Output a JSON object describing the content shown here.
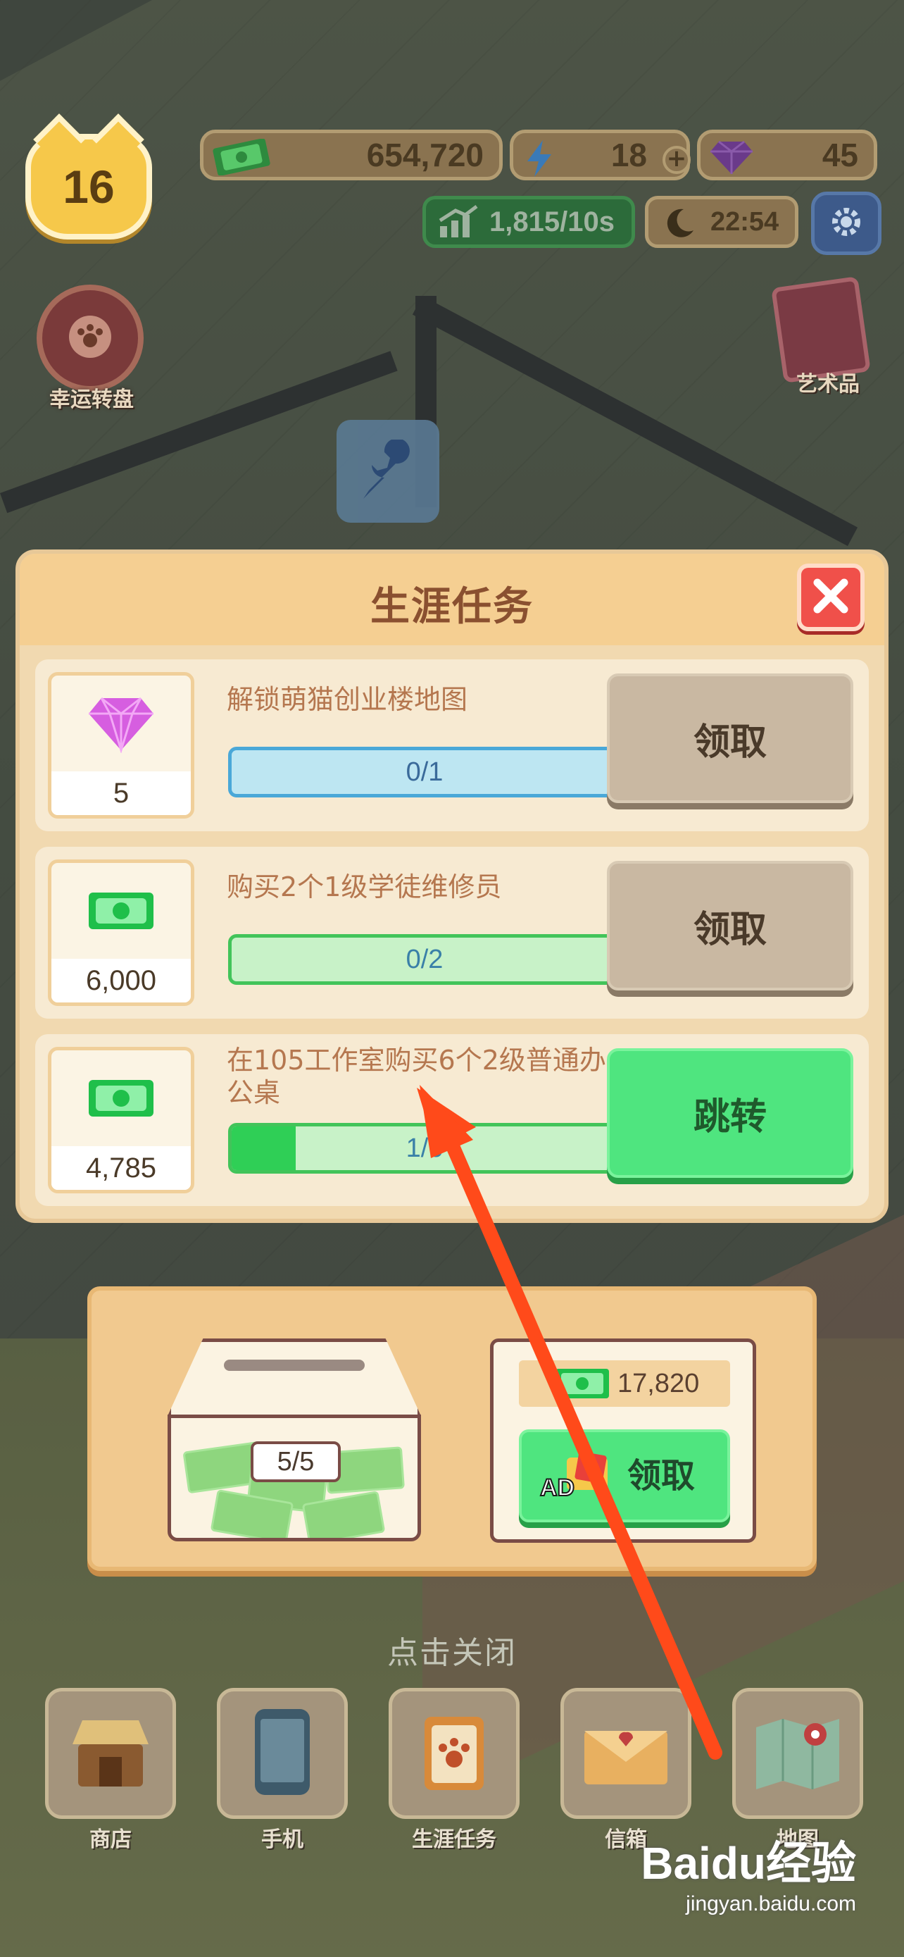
{
  "hud": {
    "level": "16",
    "cash": "654,720",
    "energy": "18",
    "gems": "45",
    "income_rate": "1,815/10s",
    "game_time": "22:54",
    "lucky_wheel_label": "幸运转盘",
    "art_label": "艺术品"
  },
  "modal": {
    "title": "生涯任务",
    "tasks": [
      {
        "reward_icon": "gem-icon",
        "reward_amount": "5",
        "description": "解锁萌猫创业楼地图",
        "progress_text": "0/1",
        "progress": 0.0,
        "button_label": "领取",
        "button_state": "disabled"
      },
      {
        "reward_icon": "cash-icon",
        "reward_amount": "6,000",
        "description": "购买2个1级学徒维修员",
        "progress_text": "0/2",
        "progress": 0.0,
        "button_label": "领取",
        "button_state": "disabled"
      },
      {
        "reward_icon": "cash-icon",
        "reward_amount": "4,785",
        "description": "在105工作室购买6个2级普通办公桌",
        "progress_text": "1/6",
        "progress": 0.1667,
        "button_label": "跳转",
        "button_state": "active"
      }
    ]
  },
  "bank": {
    "count": "5/5",
    "amount": "17,820",
    "ad_badge": "AD",
    "claim_label": "领取"
  },
  "tap_to_close": "点击关闭",
  "nav": [
    {
      "label": "商店",
      "icon": "shop-icon"
    },
    {
      "label": "手机",
      "icon": "phone-icon"
    },
    {
      "label": "生涯任务",
      "icon": "paw-clipboard-icon"
    },
    {
      "label": "信箱",
      "icon": "mail-icon"
    },
    {
      "label": "地图",
      "icon": "map-icon"
    }
  ],
  "watermark": {
    "logo": "Baidu经验",
    "url": "jingyan.baidu.com"
  },
  "colors": {
    "modal_bg": "#f1d9b0",
    "header_bg": "#f5cf92",
    "title": "#8a5030",
    "close_red": "#f0504a",
    "claim_grey": "#c9b8a2",
    "go_green": "#4fe57f",
    "annotation_arrow": "#ff4a1a"
  }
}
